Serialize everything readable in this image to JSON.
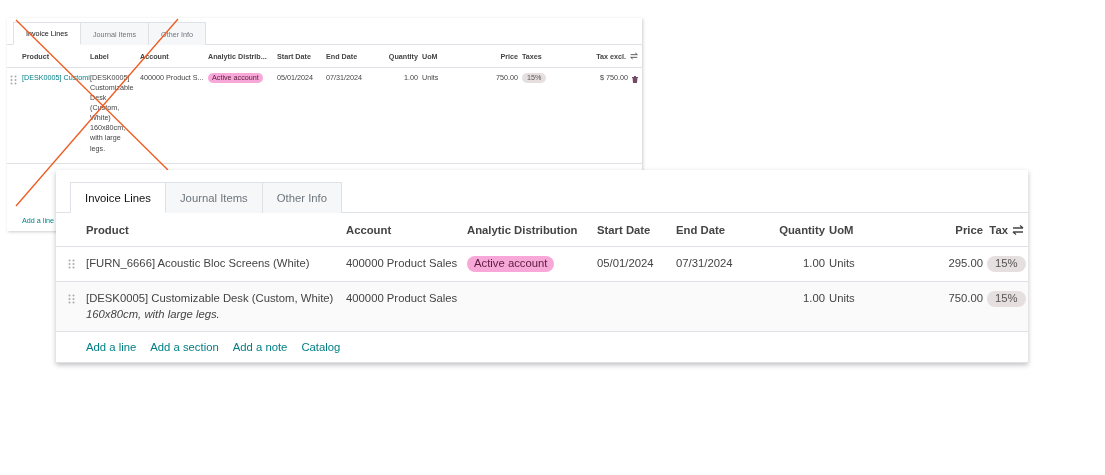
{
  "panels": [
    {
      "kind": "compact",
      "tabs": [
        {
          "label": "Invoice Lines",
          "selected": true
        },
        {
          "label": "Journal Items",
          "selected": false
        },
        {
          "label": "Other Info",
          "selected": false
        }
      ],
      "columns": [
        {
          "label": "Product",
          "kind": "text"
        },
        {
          "label": "Label",
          "kind": "text"
        },
        {
          "label": "Account",
          "kind": "text"
        },
        {
          "label": "Analytic Distrib...",
          "kind": "text"
        },
        {
          "label": "Start Date",
          "kind": "text"
        },
        {
          "label": "End Date",
          "kind": "text"
        },
        {
          "label": "Quantity",
          "kind": "number"
        },
        {
          "label": "UoM",
          "kind": "text"
        },
        {
          "label": "Price",
          "kind": "number"
        },
        {
          "label": "Taxes",
          "kind": "text"
        },
        {
          "label": "Tax excl.",
          "kind": "number"
        }
      ],
      "rows": [
        {
          "cells": [
            {
              "text": "[DESK0005] Customi",
              "kind": "link"
            },
            {
              "text": "[DESK0005] Customizable Desk (Custom, White) 160x80cm, with large legs.",
              "kind": "text"
            },
            {
              "text": "400000 Product S...",
              "kind": "text"
            },
            {
              "text": "Active account",
              "kind": "badge"
            },
            {
              "text": "05/01/2024",
              "kind": "text"
            },
            {
              "text": "07/31/2024",
              "kind": "text"
            },
            {
              "text": "1.00",
              "kind": "text"
            },
            {
              "text": "Units",
              "kind": "text"
            },
            {
              "text": "750.00",
              "kind": "text"
            },
            {
              "text": "15%",
              "kind": "pill"
            },
            {
              "text": "$ 750.00",
              "kind": "text"
            }
          ]
        }
      ],
      "footer_links": [
        "Add a line"
      ]
    },
    {
      "kind": "wide",
      "tabs": [
        {
          "label": "Invoice Lines",
          "selected": true
        },
        {
          "label": "Journal Items",
          "selected": false
        },
        {
          "label": "Other Info",
          "selected": false
        }
      ],
      "columns": [
        {
          "label": "Product",
          "kind": "text"
        },
        {
          "label": "Account",
          "kind": "text"
        },
        {
          "label": "Analytic Distribution",
          "kind": "text"
        },
        {
          "label": "Start Date",
          "kind": "text"
        },
        {
          "label": "End Date",
          "kind": "text"
        },
        {
          "label": "Quantity",
          "kind": "number"
        },
        {
          "label": "UoM",
          "kind": "text"
        },
        {
          "label": "Price",
          "kind": "number"
        },
        {
          "label": "Tax",
          "kind": "text"
        }
      ],
      "rows": [
        {
          "cells": [
            {
              "text": "[FURN_6666] Acoustic Bloc Screens (White)",
              "kind": "text"
            },
            {
              "text": "400000 Product Sales",
              "kind": "text"
            },
            {
              "text": "Active account",
              "kind": "badge"
            },
            {
              "text": "05/01/2024",
              "kind": "text"
            },
            {
              "text": "07/31/2024",
              "kind": "text"
            },
            {
              "text": "1.00",
              "kind": "text"
            },
            {
              "text": "Units",
              "kind": "text"
            },
            {
              "text": "295.00",
              "kind": "text"
            },
            {
              "text": "15%",
              "kind": "pill"
            }
          ]
        },
        {
          "cells": [
            {
              "text": "[DESK0005] Customizable Desk (Custom, White)",
              "note": "160x80cm, with large legs.",
              "kind": "text"
            },
            {
              "text": "400000 Product Sales",
              "kind": "text"
            },
            null,
            null,
            null,
            {
              "text": "1.00",
              "kind": "text"
            },
            {
              "text": "Units",
              "kind": "text"
            },
            {
              "text": "750.00",
              "kind": "text"
            },
            {
              "text": "15%",
              "kind": "pill"
            }
          ]
        }
      ],
      "footer_links": [
        "Add a line",
        "Add a section",
        "Add a note",
        "Catalog"
      ]
    }
  ]
}
